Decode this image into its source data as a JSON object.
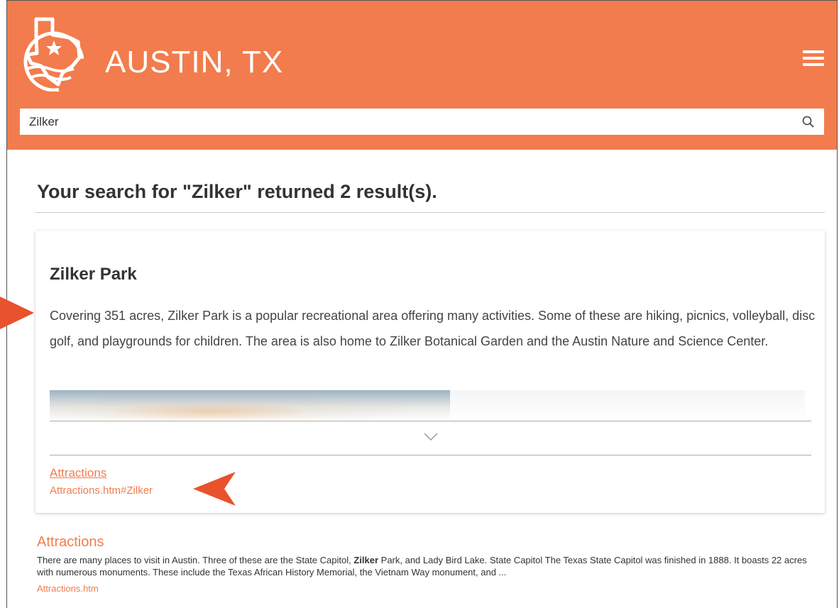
{
  "header": {
    "site_title": "AUSTIN, TX",
    "logo_icon": "texas-star-logo-icon",
    "menu_icon": "hamburger-menu-icon",
    "brand_color": "#f27c4d"
  },
  "search": {
    "value": "Zilker",
    "icon": "search-icon"
  },
  "results": {
    "heading": "Your search for \"Zilker\" returned 2 result(s).",
    "featured": {
      "title": "Zilker Park",
      "description": "Covering 351 acres, Zilker Park is a popular recreational area offering many activities. Some of these are hiking, picnics, volleyball, disc golf, and playgrounds for children. The area is also home to Zilker Botanical Garden and the Austin Nature and Science Center.",
      "expand_icon": "chevron-down-icon",
      "link_label": "Attractions",
      "link_url": "Attractions.htm#Zilker"
    },
    "second": {
      "title": "Attractions",
      "snippet_before": "There are many places to visit in Austin. Three of these are the State Capitol, ",
      "snippet_highlight": "Zilker",
      "snippet_after": " Park, and Lady Bird Lake. State Capitol The Texas State Capitol was finished in 1888. It boasts 22 acres with numerous monuments. These include the Texas African History Memorial, the Vietnam Way monument, and ...",
      "url": "Attractions.htm"
    }
  },
  "annotations": {
    "arrow_color": "#e8522c",
    "left_arrow_icon": "callout-arrow-icon",
    "link_arrow_icon": "callout-pointer-icon"
  }
}
